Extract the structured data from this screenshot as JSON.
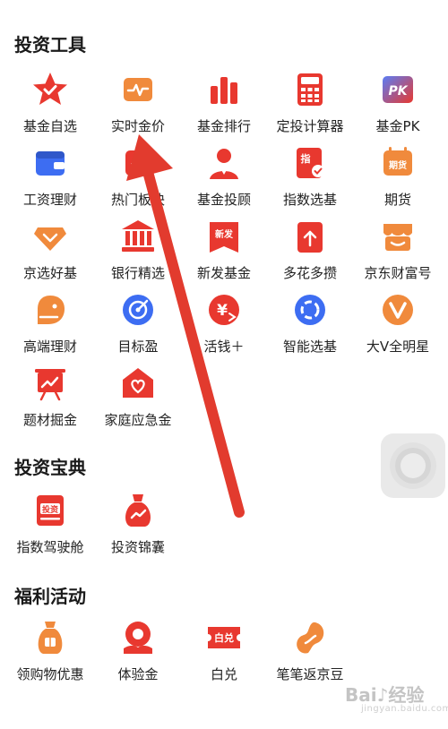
{
  "sections": {
    "tools": {
      "title": "投资工具",
      "items": [
        {
          "label": "基金自选",
          "icon": "star-icon"
        },
        {
          "label": "实时金价",
          "icon": "pulse-icon"
        },
        {
          "label": "基金排行",
          "icon": "bar-chart-icon"
        },
        {
          "label": "定投计算器",
          "icon": "calculator-icon"
        },
        {
          "label": "基金PK",
          "icon": "pk-icon",
          "badge": "PK"
        },
        {
          "label": "工资理财",
          "icon": "wallet-icon"
        },
        {
          "label": "热门板块",
          "icon": "hot-sector-icon"
        },
        {
          "label": "基金投顾",
          "icon": "advisor-icon"
        },
        {
          "label": "指数选基",
          "icon": "index-icon",
          "badge": "指"
        },
        {
          "label": "期货",
          "icon": "futures-icon",
          "badge": "期货"
        },
        {
          "label": "京选好基",
          "icon": "diamond-icon"
        },
        {
          "label": "银行精选",
          "icon": "bank-icon"
        },
        {
          "label": "新发基金",
          "icon": "new-fund-icon",
          "badge": "新发"
        },
        {
          "label": "多花多攒",
          "icon": "bag-arrow-icon"
        },
        {
          "label": "京东财富号",
          "icon": "shop-icon"
        },
        {
          "label": "高端理财",
          "icon": "premium-icon"
        },
        {
          "label": "目标盈",
          "icon": "target-icon"
        },
        {
          "label": "活钱＋",
          "icon": "yuan-icon"
        },
        {
          "label": "智能选基",
          "icon": "smart-ring-icon"
        },
        {
          "label": "大V全明星",
          "icon": "v-star-icon"
        },
        {
          "label": "题材掘金",
          "icon": "board-trend-icon"
        },
        {
          "label": "家庭应急金",
          "icon": "home-heart-icon"
        }
      ]
    },
    "guide": {
      "title": "投资宝典",
      "items": [
        {
          "label": "指数驾驶舱",
          "icon": "invest-badge-icon",
          "badge": "投资"
        },
        {
          "label": "投资锦囊",
          "icon": "pouch-icon"
        }
      ]
    },
    "welfare": {
      "title": "福利活动",
      "items": [
        {
          "label": "领购物优惠",
          "icon": "coupon-bag-icon"
        },
        {
          "label": "体验金",
          "icon": "trial-gold-icon"
        },
        {
          "label": "白兑",
          "icon": "ticket-icon",
          "badge": "白兑"
        },
        {
          "label": "笔笔返京豆",
          "icon": "bean-icon"
        }
      ]
    }
  },
  "watermark": {
    "brand": "Bai♪经验",
    "sub": "jingyan.baidu.com"
  },
  "colors": {
    "accent": "#e8382f",
    "orange": "#f0913a",
    "blue": "#3d6df2",
    "arrow": "#e23b2e"
  }
}
